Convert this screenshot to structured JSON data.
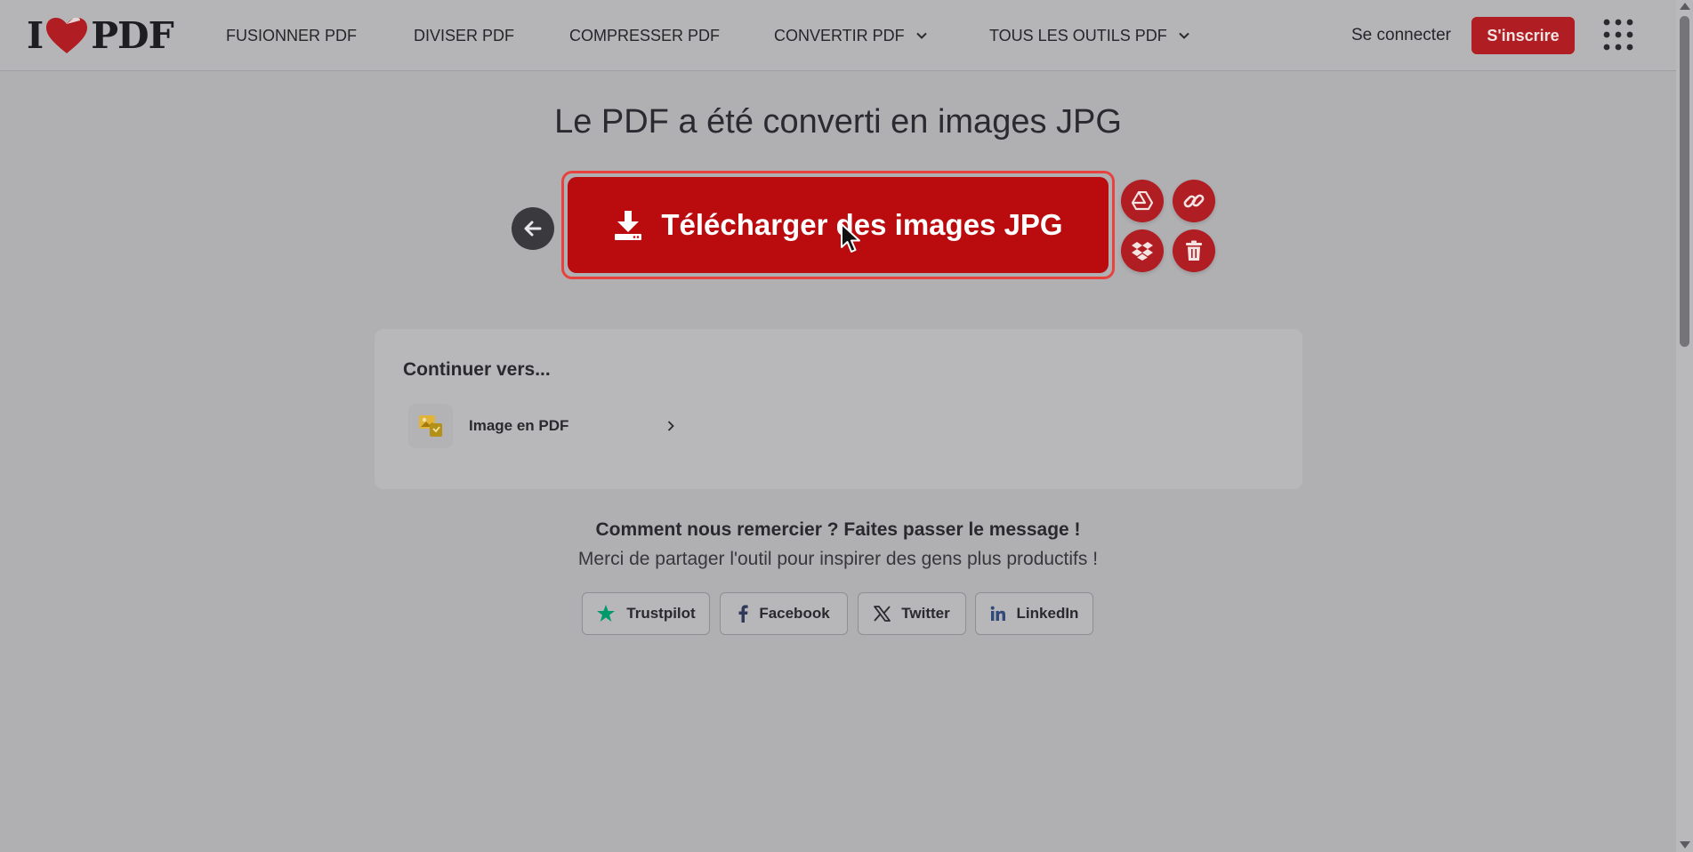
{
  "header": {
    "logo_left": "I",
    "logo_right": "PDF",
    "nav": [
      {
        "label": "FUSIONNER PDF"
      },
      {
        "label": "DIVISER PDF"
      },
      {
        "label": "COMPRESSER PDF"
      },
      {
        "label": "CONVERTIR PDF"
      },
      {
        "label": "TOUS LES OUTILS PDF"
      }
    ],
    "login_label": "Se connecter",
    "signup_label": "S'inscrire"
  },
  "main": {
    "title": "Le PDF a été converti en images JPG",
    "download_label": "Télécharger des images JPG",
    "actions": [
      "google-drive-icon",
      "link-icon",
      "dropbox-icon",
      "trash-icon"
    ]
  },
  "continue": {
    "title": "Continuer vers...",
    "tools": [
      {
        "label": "Image en PDF"
      }
    ]
  },
  "share": {
    "title": "Comment nous remercier ? Faites passer le message !",
    "subtitle": "Merci de partager l'outil pour inspirer des gens plus productifs !",
    "buttons": [
      {
        "label": "Trustpilot"
      },
      {
        "label": "Facebook"
      },
      {
        "label": "Twitter"
      },
      {
        "label": "LinkedIn"
      }
    ]
  },
  "colors": {
    "brand_red": "#b01d22",
    "download_red": "#ba0b0f",
    "trustpilot_green": "#00996a"
  }
}
